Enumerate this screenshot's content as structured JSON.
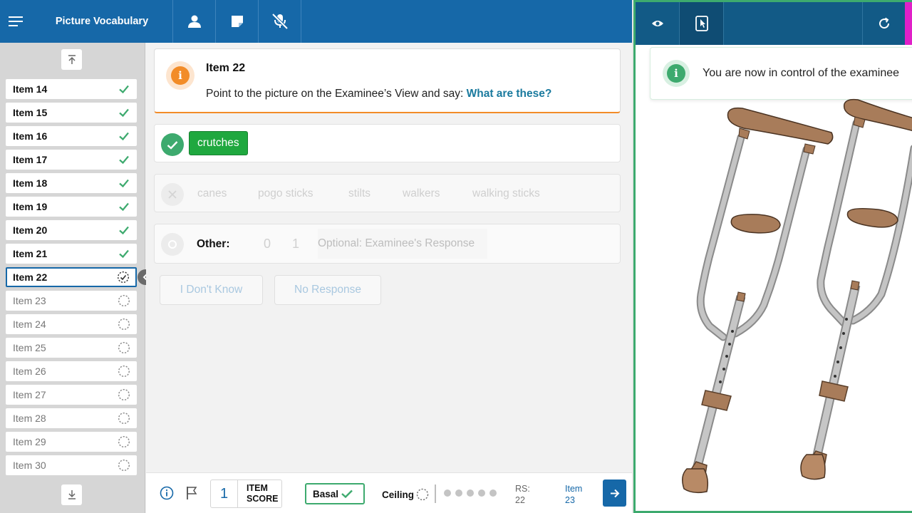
{
  "app": {
    "title": "Picture Vocabulary"
  },
  "topbar": {
    "icons": [
      "menu-icon",
      "person-icon",
      "note-icon",
      "mic-off-icon"
    ]
  },
  "sidebar": {
    "items": [
      {
        "label": "Item 14",
        "status": "done"
      },
      {
        "label": "Item 15",
        "status": "done"
      },
      {
        "label": "Item 16",
        "status": "done"
      },
      {
        "label": "Item 17",
        "status": "done"
      },
      {
        "label": "Item 18",
        "status": "done"
      },
      {
        "label": "Item 19",
        "status": "done"
      },
      {
        "label": "Item 20",
        "status": "done"
      },
      {
        "label": "Item 21",
        "status": "done"
      },
      {
        "label": "Item 22",
        "status": "current"
      },
      {
        "label": "Item 23",
        "status": "pending"
      },
      {
        "label": "Item 24",
        "status": "pending"
      },
      {
        "label": "Item 25",
        "status": "pending"
      },
      {
        "label": "Item 26",
        "status": "pending"
      },
      {
        "label": "Item 27",
        "status": "pending"
      },
      {
        "label": "Item 28",
        "status": "pending"
      },
      {
        "label": "Item 29",
        "status": "pending"
      },
      {
        "label": "Item 30",
        "status": "pending"
      }
    ]
  },
  "prompt": {
    "title": "Item 22",
    "instruction": "Point to the picture on the Examinee’s View and say: ",
    "question": "What are these?"
  },
  "correct_answer": "crutches",
  "incorrect_answers": [
    "canes",
    "pogo sticks",
    "stilts",
    "walkers",
    "walking sticks"
  ],
  "other": {
    "label": "Other:",
    "scores": [
      "0",
      "1"
    ],
    "placeholder": "Optional: Examinee's Response"
  },
  "response_buttons": {
    "dont_know": "I Don't Know",
    "no_response": "No Response"
  },
  "bottom": {
    "item_score_value": "1",
    "item_score_label": "ITEM SCORE",
    "basal_label": "Basal",
    "ceiling_label": "Ceiling",
    "rs_label": "RS:",
    "rs_value": "22",
    "next_item_label": "Item",
    "next_item_number": "23"
  },
  "examinee": {
    "notice": "You are now in control of the examinee",
    "icons": [
      "eye-icon",
      "tablet-touch-icon",
      "refresh-icon"
    ]
  },
  "colors": {
    "primary": "#1668a8",
    "success": "#3daa6e",
    "warning": "#f28c28",
    "examinee_bar": "#125a86",
    "accent": "#e020c8"
  }
}
